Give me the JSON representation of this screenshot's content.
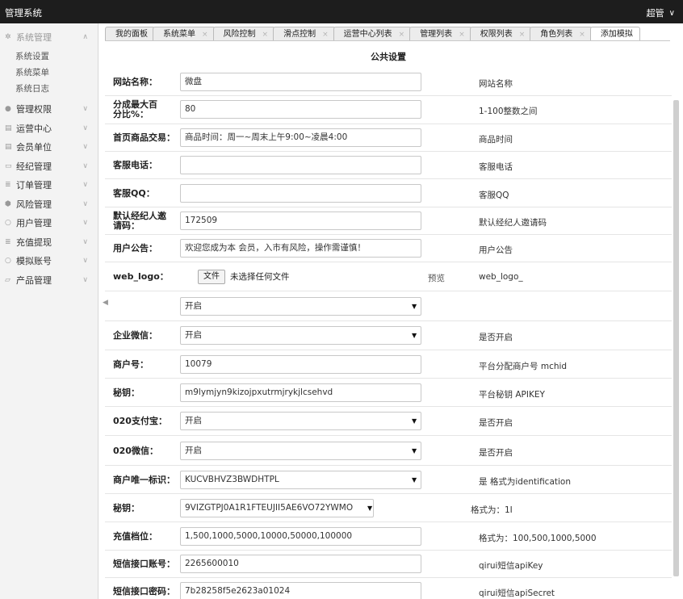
{
  "app": {
    "title": "管理系统",
    "user": "超管"
  },
  "sidebar": {
    "groups": [
      {
        "label": "系统管理",
        "open": true,
        "items": [
          "系统设置",
          "系统菜单",
          "系统日志"
        ]
      },
      {
        "label": "管理权限"
      },
      {
        "label": "运营中心"
      },
      {
        "label": "会员单位"
      },
      {
        "label": "经纪管理"
      },
      {
        "label": "订单管理"
      },
      {
        "label": "风险管理"
      },
      {
        "label": "用户管理"
      },
      {
        "label": "充值提现"
      },
      {
        "label": "模拟账号"
      },
      {
        "label": "产品管理"
      }
    ]
  },
  "tabs": [
    "我的面板",
    "系统菜单",
    "风险控制",
    "滑点控制",
    "运营中心列表",
    "管理列表",
    "权限列表",
    "角色列表",
    "添加模拟"
  ],
  "page": {
    "title": "公共设置"
  },
  "form": {
    "site_name": {
      "label": "网站名称：",
      "value": "微盘",
      "hint": "网站名称"
    },
    "max_share": {
      "label": "分成最大百分比%：",
      "value": "80",
      "hint": "1-100整数之间"
    },
    "home_trade": {
      "label": "首页商品交易：",
      "value": "商品时间：周一~周末上午9:00~凌晨4:00",
      "hint": "商品时间"
    },
    "cs_phone": {
      "label": "客服电话：",
      "value": "",
      "hint": "客服电话"
    },
    "cs_qq": {
      "label": "客服QQ：",
      "value": "",
      "hint": "客服QQ"
    },
    "invite_code": {
      "label": "默认经纪人邀请码：",
      "value": "172509",
      "hint": "默认经纪人邀请码"
    },
    "notice": {
      "label": "用户公告：",
      "value": "欢迎您成为本 会员，入市有风险，操作需谨慎！",
      "hint": "用户公告"
    },
    "web_logo": {
      "label": "web_logo：",
      "button": "文件",
      "status": "未选择任何文件",
      "preview": "预览",
      "hint": "web_logo_"
    },
    "unnamed_select": {
      "label": "",
      "value": "开启",
      "hint": ""
    },
    "wechat_ent": {
      "label": "企业微信：",
      "value": "开启",
      "hint": "是否开启"
    },
    "merchant_no": {
      "label": "商户号：",
      "value": "10079",
      "hint": "平台分配商户号 mchid"
    },
    "secret": {
      "label": "秘钥：",
      "value": "m9lymjyn9kizojpxutrmjrykjlcsehvd",
      "hint": "平台秘钥 APIKEY"
    },
    "alipay_020": {
      "label": "020支付宝：",
      "value": "开启",
      "hint": "是否开启"
    },
    "wechat_020": {
      "label": "020微信：",
      "value": "开启",
      "hint": "是否开启"
    },
    "merchant_id": {
      "label": "商户唯一标识：",
      "value": "KUCVBHVZ3BWDHTPL",
      "hint": "是 格式为identification"
    },
    "secret2": {
      "label": "秘钥：",
      "value": "9VIZGTPJ0A1R1FTEUJII5AE6VO72YWMO",
      "hint": "格式为：1I"
    },
    "recharge_levels": {
      "label": "充值档位：",
      "value": "1,500,1000,5000,10000,50000,100000",
      "hint": "格式为：100,500,1000,5000"
    },
    "sms_account": {
      "label": "短信接口账号：",
      "value": "2265600010",
      "hint": "qirui短信apiKey"
    },
    "sms_password": {
      "label": "短信接口密码：",
      "value": "7b28258f5e2623a01024",
      "hint": "qirui短信apiSecret"
    }
  }
}
